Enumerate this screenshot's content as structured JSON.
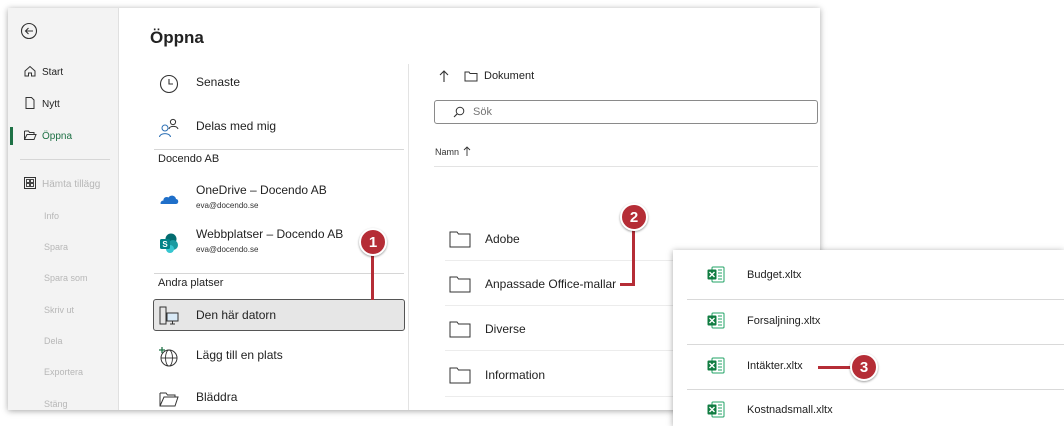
{
  "title": "Öppna",
  "nav": {
    "items": [
      {
        "label": "Start",
        "icon": "home-icon"
      },
      {
        "label": "Nytt",
        "icon": "new-document-icon"
      },
      {
        "label": "Öppna",
        "icon": "folder-open-icon"
      },
      {
        "label": "Hämta tillägg",
        "icon": "add-ins-icon"
      }
    ],
    "plain": [
      "Info",
      "Spara",
      "Spara som",
      "Skriv ut",
      "Dela",
      "Exportera",
      "Stäng"
    ]
  },
  "locations": {
    "recent": "Senaste",
    "shared": "Delas med mig",
    "group1": "Docendo AB",
    "onedrive": {
      "name": "OneDrive – Docendo AB",
      "account": "eva@docendo.se"
    },
    "sites": {
      "name": "Webbplatser – Docendo AB",
      "account": "eva@docendo.se"
    },
    "group2": "Andra platser",
    "this_pc": "Den här datorn",
    "add_place": "Lägg till en plats",
    "browse": "Bläddra"
  },
  "browser": {
    "breadcrumb": "Dokument",
    "search_placeholder": "Sök",
    "column": "Namn",
    "folders": [
      "Adobe",
      "Anpassade Office-mallar",
      "Diverse",
      "Information"
    ]
  },
  "files": [
    "Budget.xltx",
    "Forsaljning.xltx",
    "Intäkter.xltx",
    "Kostnadsmall.xltx"
  ],
  "callouts": [
    "1",
    "2",
    "3"
  ],
  "colors": {
    "accent": "#1e7145",
    "callout": "#b52d36"
  }
}
